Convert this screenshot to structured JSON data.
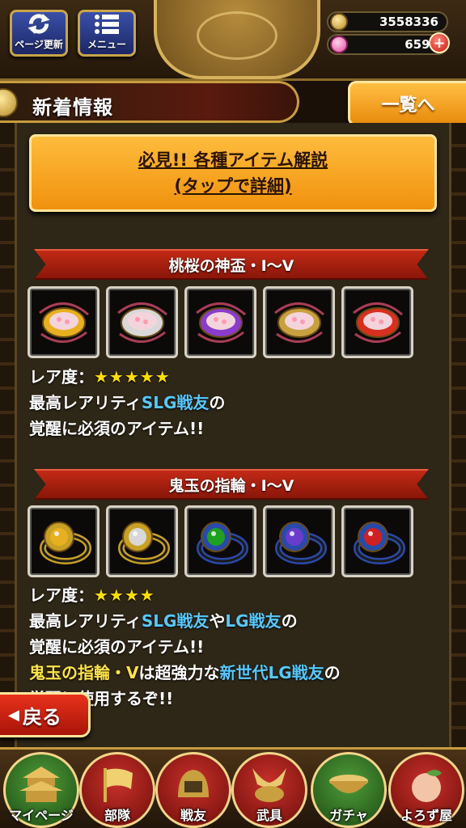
{
  "header": {
    "refresh_label": "ページ更新",
    "menu_label": "メニュー",
    "gold": "3558336",
    "gems": "6590",
    "plus": "+"
  },
  "section": {
    "title": "新着情報",
    "list_button": "一覧へ"
  },
  "guide_button": {
    "line1": "必見!! 各種アイテム解説",
    "line2": "(タップで詳細)"
  },
  "items": [
    {
      "title": "桃桜の神盃・I〜V",
      "icon": "sake-cup-icon",
      "colors": [
        "#e8b020",
        "#d8d8d8",
        "#8a3ccc",
        "#c8a040",
        "#d83020"
      ],
      "rarity_label": "レア度：",
      "rarity_stars": "★★★★★",
      "desc_prefix": "最高レアリティ",
      "desc_hl1": "SLG戦友",
      "desc_suffix": "の",
      "desc_line2": "覚醒に必須のアイテム!!"
    },
    {
      "title": "鬼玉の指輪・I〜V",
      "icon": "ring-icon",
      "colors": [
        "#e8b020",
        "#d8d8d8",
        "#20a020",
        "#6a3ccc",
        "#d02020"
      ],
      "rarity_label": "レア度：",
      "rarity_stars": "★★★★",
      "desc_prefix": "最高レアリティ",
      "desc_hl1": "SLG戦友",
      "desc_mid": "や",
      "desc_hl2": "LG戦友",
      "desc_suffix": "の",
      "desc_line2": "覚醒に必須のアイテム!!",
      "desc_line3_hl": "鬼玉の指輪・V",
      "desc_line3_mid": "は超強力な",
      "desc_line3_hl2": "新世代LG戦友",
      "desc_line3_suffix": "の",
      "desc_line4": "覚醒に使用するぞ!!"
    }
  ],
  "back_button": "戻る",
  "nav": [
    {
      "label": "マイページ",
      "icon": "castle-icon"
    },
    {
      "label": "部隊",
      "icon": "flag-icon"
    },
    {
      "label": "戦友",
      "icon": "helmet-icon"
    },
    {
      "label": "武具",
      "icon": "kabuto-icon"
    },
    {
      "label": "ガチャ",
      "icon": "bowl-icon"
    },
    {
      "label": "よろず屋",
      "icon": "peach-icon"
    }
  ]
}
